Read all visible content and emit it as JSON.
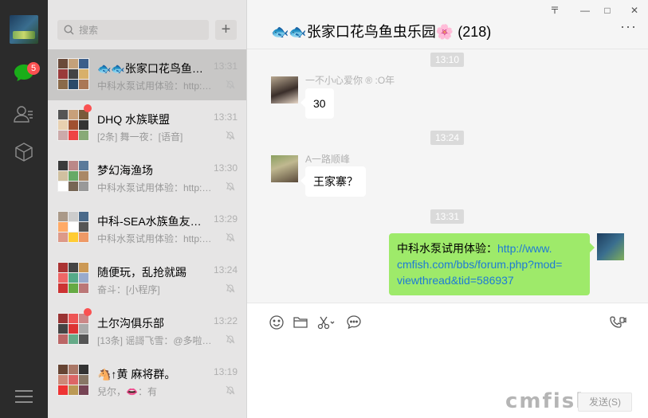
{
  "nav": {
    "unread_badge": "5",
    "items": [
      "chat-icon",
      "contacts-icon",
      "favorites-icon"
    ],
    "menu": "menu-icon"
  },
  "search": {
    "placeholder": "搜索",
    "add": "+"
  },
  "conversations": [
    {
      "name": "🐟🐟张家口花鸟鱼…",
      "time": "13:31",
      "preview": "中科水泵试用体验：http:…",
      "active": true,
      "dot": false,
      "colors": [
        "#6a4a3a",
        "#c4a17a",
        "#3c5e8a",
        "#9a3a3a",
        "#444",
        "#d8b06a",
        "#8a6a4a",
        "#2a4a6a",
        "#aa7755"
      ]
    },
    {
      "name": "DHQ 水族联盟",
      "time": "13:31",
      "preview": "[2条] 舞一夜：[语音]",
      "active": false,
      "dot": true,
      "colors": [
        "#555",
        "#c8a07a",
        "#7a5a3a",
        "#e8d0b0",
        "#a05030",
        "#333",
        "#caa",
        "#e44",
        "#8a7"
      ]
    },
    {
      "name": "梦幻海渔场",
      "time": "13:30",
      "preview": "中科水泵试用体验：http:…",
      "active": false,
      "dot": false,
      "colors": [
        "#3a3a3a",
        "#b88",
        "#5a7a9a",
        "#d0c0a0",
        "#6a6",
        "#a86",
        "#fff",
        "#765",
        "#999"
      ]
    },
    {
      "name": "中科-SEA水族鱼友…",
      "time": "13:29",
      "preview": "中科水泵试用体验：http:…",
      "active": false,
      "dot": false,
      "colors": [
        "#a98",
        "#ccc",
        "#4a6a8a",
        "#fa6",
        "#fff",
        "#555",
        "#d98",
        "#fc3",
        "#e96"
      ]
    },
    {
      "name": "随便玩，乱抢就踢",
      "time": "13:24",
      "preview": "奋斗：[小程序]",
      "active": false,
      "dot": false,
      "colors": [
        "#a33",
        "#444",
        "#c95",
        "#e66",
        "#5a8",
        "#9ac",
        "#c33",
        "#6a4",
        "#b77"
      ]
    },
    {
      "name": "土尔沟俱乐部",
      "time": "13:22",
      "preview": "[13条] 谣謌飞雪：@多啦…",
      "active": false,
      "dot": true,
      "colors": [
        "#933",
        "#e55",
        "#c88",
        "#444",
        "#d33",
        "#aaa",
        "#b66",
        "#6a8",
        "#555"
      ]
    },
    {
      "name": "🐴↑黄  麻将群。",
      "time": "13:19",
      "preview": "兒尔，👄：有",
      "active": false,
      "dot": false,
      "colors": [
        "#643",
        "#a76",
        "#333",
        "#c87",
        "#d66",
        "#876",
        "#e33",
        "#b95",
        "#745"
      ]
    }
  ],
  "chat": {
    "title": "🐟🐟张家口花鸟鱼虫乐园🌸 (218)",
    "window_controls": [
      "〒",
      "—",
      "□",
      "✕"
    ],
    "more": "···",
    "messages": [
      {
        "timestamp": "13:10",
        "sender": "一不小心爱你 ® :O年",
        "text": "30",
        "mine": false
      },
      {
        "timestamp": "13:24",
        "sender": "A一路顺峰",
        "text": "王家寨？",
        "mine": false
      },
      {
        "timestamp": "13:31",
        "sender": "",
        "text_prefix": "中科水泵试用体验：",
        "link": "http://www.cmfish.com/bbs/forum.php?mod=viewthread&tid=586937",
        "link_lines": [
          "http://www.",
          "cmfish.com/bbs/forum.php?mod=",
          "viewthread&tid=586937"
        ],
        "mine": true
      }
    ]
  },
  "composer": {
    "tools": [
      "emoji-icon",
      "folder-icon",
      "scissors-icon",
      "chat-history-icon"
    ],
    "call": "video-call-icon",
    "send_label": "发送(S)",
    "watermark": "cmfish"
  },
  "colors": {
    "accent_green": "#9eea6a",
    "badge_red": "#fa5151",
    "nav_bg": "#2b2b2b",
    "link": "#1e7ad6"
  }
}
